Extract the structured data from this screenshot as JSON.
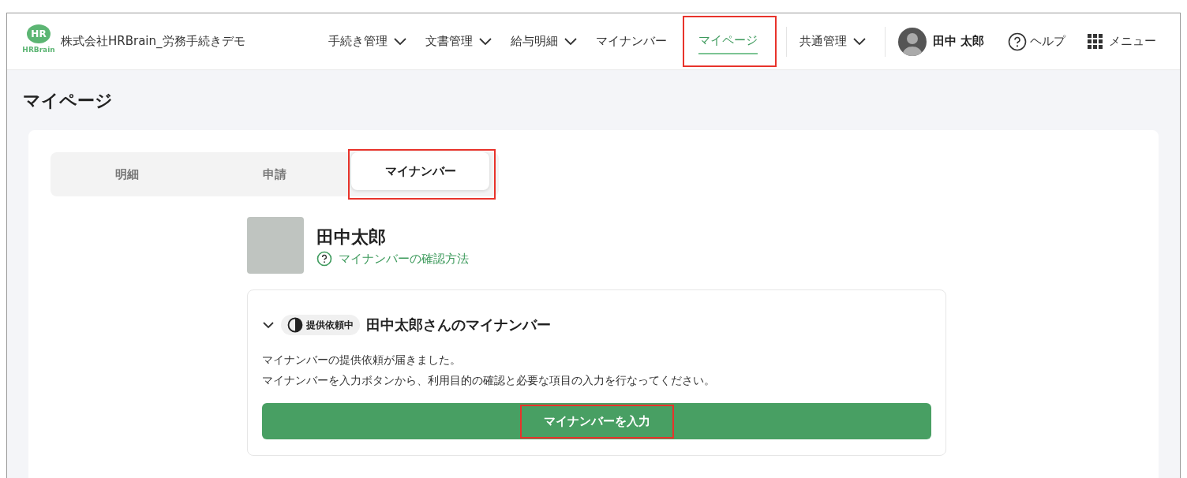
{
  "header": {
    "logo": {
      "mark": "HR",
      "wordmark": "HRBrain"
    },
    "company": "株式会社HRBrain_労務手続きデモ",
    "nav": [
      {
        "label": "手続き管理",
        "dropdown": true,
        "selected": false,
        "highlighted": false
      },
      {
        "label": "文書管理",
        "dropdown": true,
        "selected": false,
        "highlighted": false
      },
      {
        "label": "給与明細",
        "dropdown": true,
        "selected": false,
        "highlighted": false
      },
      {
        "label": "マイナンバー",
        "dropdown": false,
        "selected": false,
        "highlighted": false
      },
      {
        "label": "マイページ",
        "dropdown": false,
        "selected": true,
        "highlighted": true
      },
      {
        "label": "共通管理",
        "dropdown": true,
        "selected": false,
        "highlighted": false
      }
    ],
    "user": "田中 太郎",
    "help": "ヘルプ",
    "menu": "メニュー"
  },
  "page_title": "マイページ",
  "tabs": [
    {
      "label": "明細",
      "selected": false,
      "highlighted": false
    },
    {
      "label": "申請",
      "selected": false,
      "highlighted": false
    },
    {
      "label": "マイナンバー",
      "selected": true,
      "highlighted": true
    }
  ],
  "profile": {
    "name": "田中太郎",
    "help_link": "マイナンバーの確認方法"
  },
  "mynumber_card": {
    "expanded": true,
    "status": "提供依頼中",
    "title": "田中太郎さんのマイナンバー",
    "message": [
      "マイナンバーの提供依頼が届きました。",
      "マイナンバーを入力ボタンから、利用目的の確認と必要な項目の入力を行なってください。"
    ],
    "button": {
      "label": "マイナンバーを入力",
      "highlighted": true
    }
  }
}
